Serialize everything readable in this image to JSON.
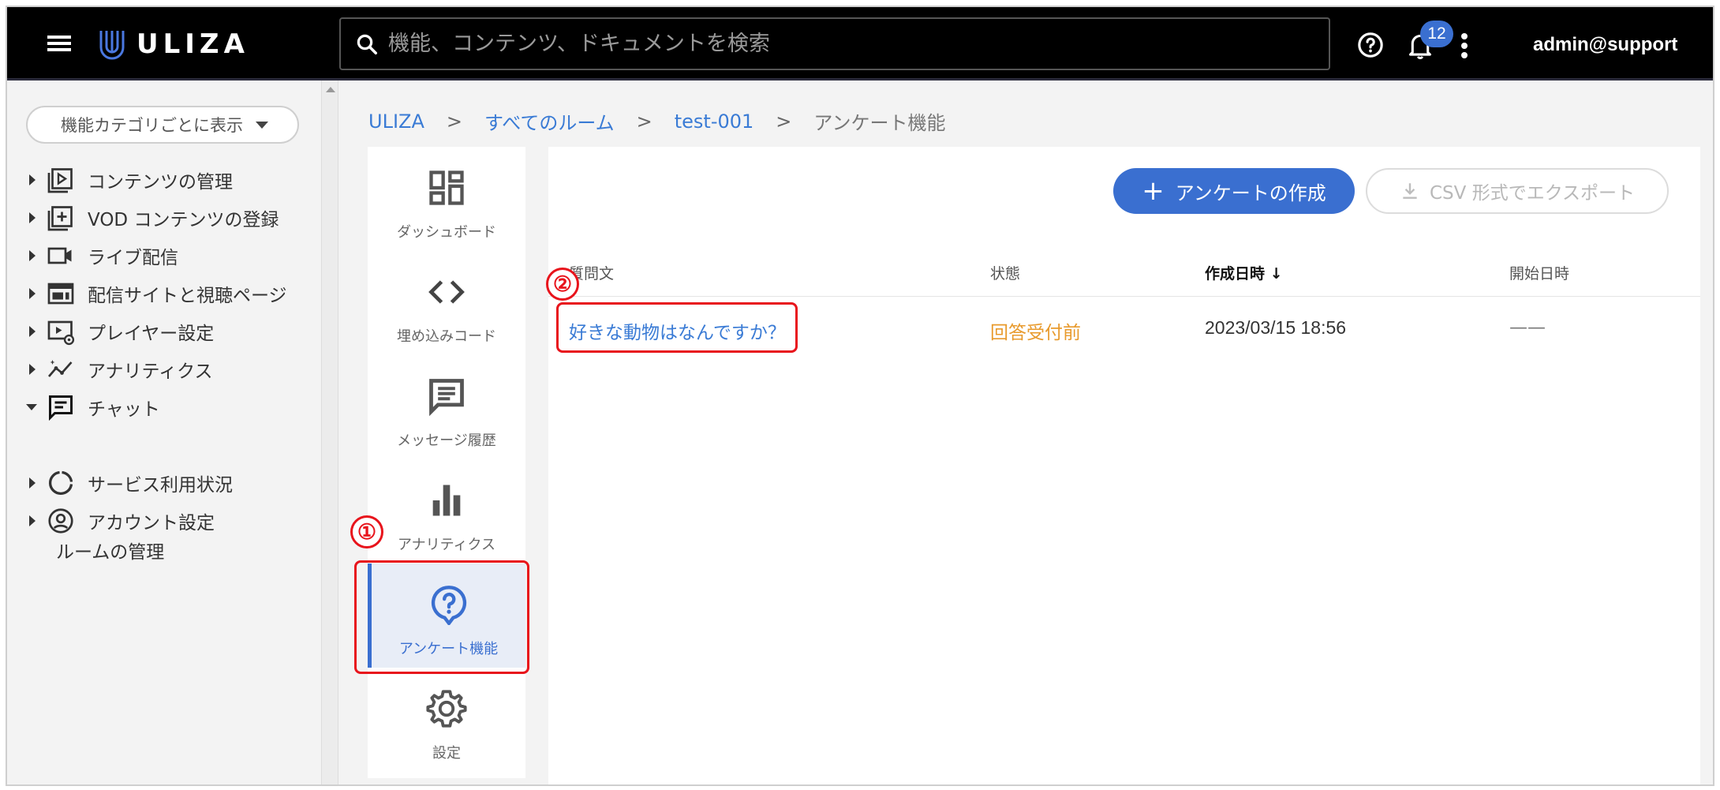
{
  "topbar": {
    "logo_text": "ULIZA",
    "search_placeholder": "機能、コンテンツ、ドキュメントを検索",
    "notification_count": "12",
    "user": "admin@support",
    "accent": "#3a6fd0"
  },
  "sidebar": {
    "category_button": "機能カテゴリごとに表示",
    "items": [
      {
        "label": "コンテンツの管理",
        "icon": "play-box-icon"
      },
      {
        "label": "VOD コンテンツの登録",
        "icon": "add-box-icon"
      },
      {
        "label": "ライブ配信",
        "icon": "video-camera-icon"
      },
      {
        "label": "配信サイトと視聴ページ",
        "icon": "web-page-icon"
      },
      {
        "label": "プレイヤー設定",
        "icon": "player-settings-icon"
      },
      {
        "label": "アナリティクス",
        "icon": "analytics-icon"
      },
      {
        "label": "チャット",
        "icon": "chat-icon"
      },
      {
        "label": "サービス利用状況",
        "icon": "usage-ring-icon"
      },
      {
        "label": "アカウント設定",
        "icon": "account-icon"
      }
    ],
    "sub_item": "ルームの管理"
  },
  "breadcrumb": {
    "items": [
      "ULIZA",
      "すべてのルーム",
      "test-001"
    ],
    "current": "アンケート機能",
    "separator": ">"
  },
  "subnav": {
    "items": [
      {
        "label": "ダッシュボード",
        "icon": "dashboard-icon"
      },
      {
        "label": "埋め込みコード",
        "icon": "code-icon"
      },
      {
        "label": "メッセージ履歴",
        "icon": "message-icon"
      },
      {
        "label": "アナリティクス",
        "icon": "bar-chart-icon"
      },
      {
        "label": "アンケート機能",
        "icon": "survey-icon",
        "active": true
      },
      {
        "label": "設定",
        "icon": "gear-icon"
      }
    ]
  },
  "toolbar": {
    "create_label": "アンケートの作成",
    "export_label": "CSV 形式でエクスポート"
  },
  "table": {
    "headers": [
      "質問文",
      "状態",
      "作成日時",
      "開始日時"
    ],
    "sort_indicator": "↓",
    "rows": [
      {
        "question": "好きな動物はなんですか？",
        "status": "回答受付前",
        "created": "2023/03/15 18:56",
        "started": "——"
      }
    ]
  },
  "annotations": [
    "①",
    "②"
  ],
  "colors": {
    "link": "#3a7bd5",
    "status_pending": "#e89a2c",
    "annotation": "#e8141c"
  }
}
